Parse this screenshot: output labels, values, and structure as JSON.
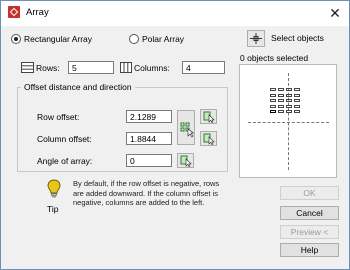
{
  "window": {
    "title": "Array",
    "close_glyph": "✕"
  },
  "array_type": {
    "rectangular_label": "Rectangular Array",
    "polar_label": "Polar Array",
    "selected": "rectangular"
  },
  "select_objects": {
    "label": "Select objects",
    "status": "0 objects selected"
  },
  "grid": {
    "rows_label": "Rows:",
    "rows_value": "5",
    "columns_label": "Columns:",
    "columns_value": "4"
  },
  "offset": {
    "legend": "Offset distance and direction",
    "row_offset_label": "Row offset:",
    "row_offset_value": "2.1289",
    "column_offset_label": "Column offset:",
    "column_offset_value": "1.8844",
    "angle_label": "Angle of array:",
    "angle_value": "0"
  },
  "tip": {
    "label": "Tip",
    "text": "By default, if the row offset is negative, rows are added downward.  If the column offset is negative, columns are added to the left."
  },
  "buttons": {
    "ok": "OK",
    "cancel": "Cancel",
    "preview": "Preview <",
    "help": "Help"
  },
  "preview_grid": {
    "rows": 5,
    "columns": 4,
    "selected_row": 5,
    "selected_column": 1
  },
  "colors": {
    "accent": "#c8312b",
    "pick_icon": "#2e7d32",
    "bulb": "#e6c619"
  }
}
